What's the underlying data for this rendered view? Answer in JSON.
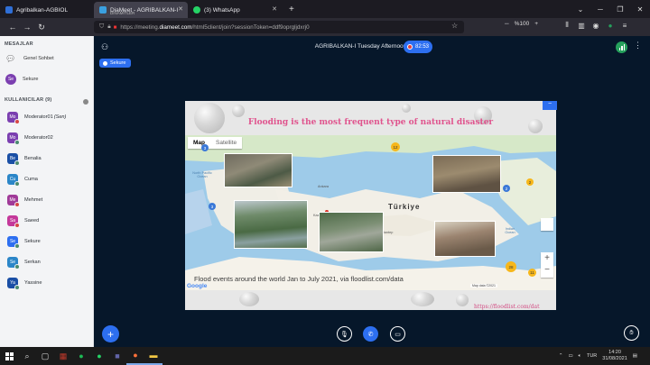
{
  "browser": {
    "tabs": [
      {
        "title": "Agribalkan-AGBIOL",
        "icon_color": "#2f6fd6",
        "active": false
      },
      {
        "title": "DiaMeet - AGRIBALKAN-I Tue",
        "subtitle": "DINAMİTLER",
        "icon_color": "#3aa0e0",
        "active": true
      },
      {
        "title": "(3) WhatsApp",
        "icon_color": "#25d366",
        "active": false
      }
    ],
    "url_prefix": "https://meeting.",
    "url_domain": "diameet.com",
    "url_rest": "/html5client/join?sessionToken=ddf9oprgljdxrj0",
    "zoom": "%100"
  },
  "sidebar": {
    "messages_title": "MESAJLAR",
    "public_chat": "Genel Sohbet",
    "private_chat": {
      "initials": "Se",
      "name": "Sekure"
    },
    "users_title": "KULLANICILAR (9)",
    "users": [
      {
        "initials": "Mo",
        "name": "Moderator01",
        "suffix": " (Sen)",
        "color": "#7b3fb0",
        "mic": "red"
      },
      {
        "initials": "Mo",
        "name": "Moderator02",
        "suffix": "",
        "color": "#7b3fb0",
        "mic": "green"
      },
      {
        "initials": "Be",
        "name": "Benalia",
        "suffix": "",
        "color": "#1a4fa5",
        "mic": "green"
      },
      {
        "initials": "Cu",
        "name": "Cuma",
        "suffix": "",
        "color": "#2b86c8",
        "mic": "green"
      },
      {
        "initials": "Me",
        "name": "Mehmet",
        "suffix": "",
        "color": "#a03a98",
        "mic": "red"
      },
      {
        "initials": "Sa",
        "name": "Saeed",
        "suffix": "",
        "color": "#c4389a",
        "mic": "red"
      },
      {
        "initials": "Se",
        "name": "Sekure",
        "suffix": "",
        "color": "#2d6ff0",
        "mic": "green"
      },
      {
        "initials": "Se",
        "name": "Serkan",
        "suffix": "",
        "color": "#2b86c8",
        "mic": "green"
      },
      {
        "initials": "Ya",
        "name": "Yassine",
        "suffix": "",
        "color": "#1a4fa5",
        "mic": "green"
      }
    ]
  },
  "main": {
    "session_title": "AGRIBALKAN-I Tuesday Afternoon Session",
    "timer": "82:53",
    "status_chip": "Sekure"
  },
  "slide": {
    "title": "Flooding is the most frequent type of natural disaster",
    "map_tab_map": "Map",
    "map_tab_satellite": "Satellite",
    "caption": "Flood events around the world Jan to July 2021, via floodlist.com/data",
    "country_label": "Türkiye",
    "ankara": "Ankara",
    "source": "https://floodlist.com/dat",
    "google": "Google",
    "attribution": "Map data ©2021",
    "clusters": [
      "12",
      "3",
      "3",
      "2",
      "28",
      "11",
      "2"
    ],
    "ocean_labels": [
      "North Pacific Ocean",
      "North Atlantic Ocean",
      "Indian Ocean"
    ],
    "place_labels": [
      "Kaz",
      "Gaziantep"
    ]
  },
  "taskbar": {
    "tray_lang": "TUR",
    "time": "14:20",
    "date": "31/08/2021"
  }
}
